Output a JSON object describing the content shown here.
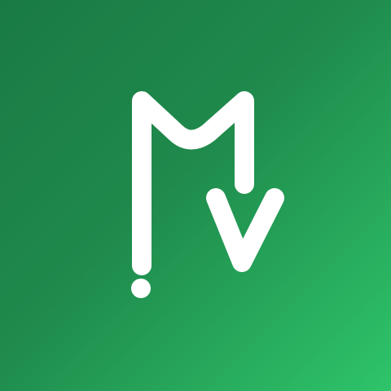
{
  "icon": {
    "name": "app-logo",
    "semantic": "letter-m-v-down-arrow-logo",
    "colors": {
      "background_start": "#1a7a44",
      "background_end": "#2ec46a",
      "glyph": "#ffffff"
    }
  }
}
